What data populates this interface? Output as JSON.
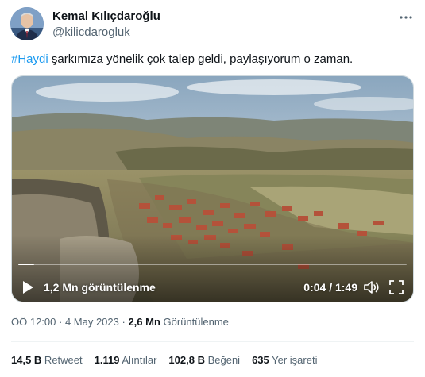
{
  "author": {
    "display_name": "Kemal Kılıçdaroğlu",
    "handle": "@kilicdarogluk",
    "avatar_icon": "profile-avatar"
  },
  "tweet": {
    "hashtag": "#Haydi",
    "text": " şarkımıza yönelik çok talep geldi, paylaşıyorum o zaman."
  },
  "video": {
    "views_label": "1,2 Mn görüntülenme",
    "time_label": "0:04 / 1:49",
    "progress_fraction": 0.04,
    "icons": [
      "play-icon",
      "volume-icon",
      "fullscreen-icon"
    ]
  },
  "meta": {
    "time": "ÖÖ 12:00",
    "separator": " · ",
    "date": "4 May 2023",
    "separator2": " · ",
    "views_count": "2,6 Mn",
    "views_label": " Görüntülenme"
  },
  "stats": {
    "retweets_count": "14,5 B",
    "retweets_label": " Retweet",
    "quotes_count": "1.119",
    "quotes_label": " Alıntılar",
    "likes_count": "102,8 B",
    "likes_label": " Beğeni",
    "bookmarks_count": "635",
    "bookmarks_label": " Yer işareti"
  },
  "colors": {
    "accent": "#1d9bf0",
    "text": "#0f1419",
    "secondary": "#536471"
  }
}
